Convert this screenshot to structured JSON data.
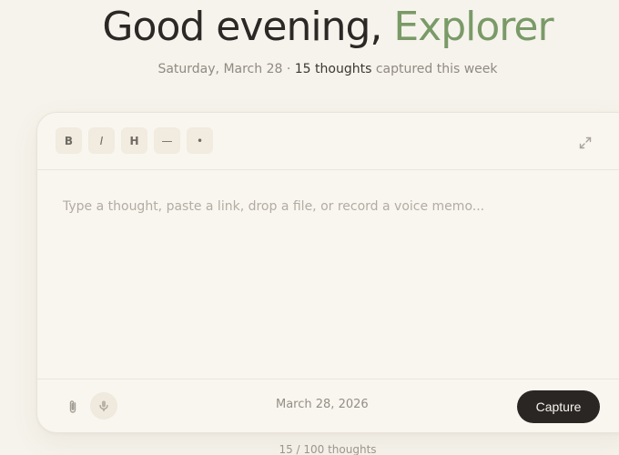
{
  "header": {
    "greeting_prefix": "Good evening,",
    "greeting_name": "Explorer",
    "date_text": "Saturday, March 28 ·",
    "thought_count": "15 thoughts",
    "week_suffix": "captured this week"
  },
  "toolbar": {
    "bold_label": "B",
    "italic_label": "I",
    "heading_label": "H",
    "divider_label": "—",
    "bullet_label": "•",
    "expand_icon": "expand-icon"
  },
  "editor": {
    "placeholder": "Type a thought, paste a link, drop a file, or record a voice memo..."
  },
  "footer": {
    "attach_icon": "paperclip-icon",
    "mic_icon": "microphone-icon",
    "date": "March 28, 2026",
    "capture_label": "Capture"
  },
  "counter": {
    "text": "15 / 100 thoughts"
  },
  "colors": {
    "background": "#f6f3ec",
    "accent_green": "#7a9a68",
    "button_dark": "#2a2624"
  }
}
